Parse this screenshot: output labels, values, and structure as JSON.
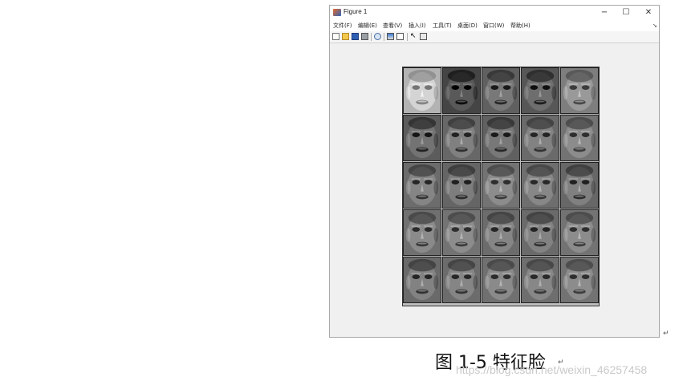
{
  "window": {
    "title": "Figure 1",
    "controls": {
      "minimize": "−",
      "maximize": "☐",
      "close": "✕"
    }
  },
  "menu": [
    {
      "label": "文件(F)"
    },
    {
      "label": "编辑(E)"
    },
    {
      "label": "查看(V)"
    },
    {
      "label": "插入(I)"
    },
    {
      "label": "工具(T)"
    },
    {
      "label": "桌面(D)"
    },
    {
      "label": "窗口(W)"
    },
    {
      "label": "帮助(H)"
    }
  ],
  "toolbar": {
    "icons": [
      "new-figure-icon",
      "open-file-icon",
      "save-icon",
      "print-icon",
      "print-preview-icon",
      "colorbar-icon",
      "legend-icon",
      "pointer-icon",
      "property-editor-icon"
    ]
  },
  "figure": {
    "grid": {
      "rows": 5,
      "cols": 5
    },
    "faces": [
      {
        "brightness": 0.78,
        "shade": "light"
      },
      {
        "brightness": 0.3,
        "shade": "dark"
      },
      {
        "brightness": 0.42,
        "shade": "dark"
      },
      {
        "brightness": 0.38,
        "shade": "dark"
      },
      {
        "brightness": 0.55,
        "shade": "mid"
      },
      {
        "brightness": 0.4,
        "shade": "mid"
      },
      {
        "brightness": 0.45,
        "shade": "mid"
      },
      {
        "brightness": 0.42,
        "shade": "mid"
      },
      {
        "brightness": 0.46,
        "shade": "mid"
      },
      {
        "brightness": 0.5,
        "shade": "mid"
      },
      {
        "brightness": 0.47,
        "shade": "mid"
      },
      {
        "brightness": 0.44,
        "shade": "mid"
      },
      {
        "brightness": 0.5,
        "shade": "mid"
      },
      {
        "brightness": 0.48,
        "shade": "mid"
      },
      {
        "brightness": 0.45,
        "shade": "mid"
      },
      {
        "brightness": 0.49,
        "shade": "mid"
      },
      {
        "brightness": 0.5,
        "shade": "mid"
      },
      {
        "brightness": 0.47,
        "shade": "mid"
      },
      {
        "brightness": 0.46,
        "shade": "mid"
      },
      {
        "brightness": 0.5,
        "shade": "mid"
      },
      {
        "brightness": 0.46,
        "shade": "mid"
      },
      {
        "brightness": 0.47,
        "shade": "mid"
      },
      {
        "brightness": 0.49,
        "shade": "mid"
      },
      {
        "brightness": 0.48,
        "shade": "mid"
      },
      {
        "brightness": 0.5,
        "shade": "mid"
      }
    ]
  },
  "document": {
    "caption": "图 1-5  特征脸",
    "return_mark": "↵",
    "watermark": "https://blog.csdn.net/weixin_46257458"
  }
}
